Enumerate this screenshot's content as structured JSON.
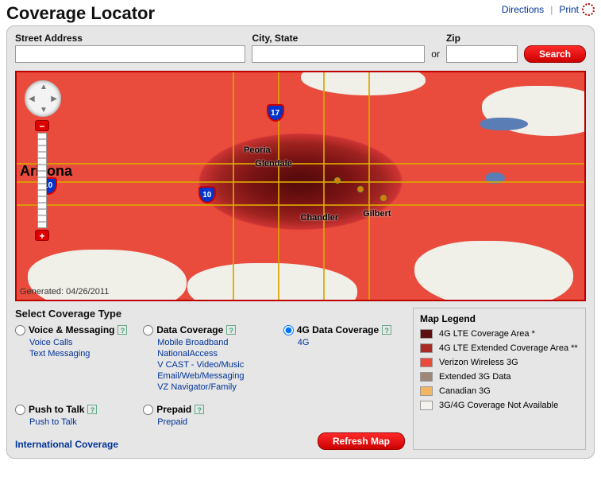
{
  "header": {
    "title": "Coverage Locator",
    "links": {
      "directions": "Directions",
      "print": "Print"
    }
  },
  "search": {
    "street_label": "Street Address",
    "city_label": "City, State",
    "zip_label": "Zip",
    "or": "or",
    "button": "Search"
  },
  "map": {
    "state_label": "Arizona",
    "generated_label": "Generated: 04/26/2011",
    "shields": {
      "i17": "17",
      "i10a": "10",
      "i10b": "10"
    },
    "cities": {
      "peoria": "Peoria",
      "glendale": "Glendale",
      "chandler": "Chandler",
      "gilbert": "Gilbert"
    }
  },
  "coverage": {
    "heading": "Select Coverage Type",
    "voice": {
      "label": "Voice & Messaging",
      "items": [
        "Voice Calls",
        "Text Messaging"
      ]
    },
    "data": {
      "label": "Data Coverage",
      "items": [
        "Mobile Broadband",
        "NationalAccess",
        "V CAST - Video/Music",
        "Email/Web/Messaging",
        "VZ Navigator/Family"
      ]
    },
    "fourg": {
      "label": "4G Data Coverage",
      "items": [
        "4G"
      ]
    },
    "ptt": {
      "label": "Push to Talk",
      "items": [
        "Push to Talk"
      ]
    },
    "prepaid": {
      "label": "Prepaid",
      "items": [
        "Prepaid"
      ]
    },
    "intl": "International Coverage",
    "refresh": "Refresh Map"
  },
  "legend": {
    "heading": "Map Legend",
    "items": [
      {
        "color": "#5e0f0f",
        "label": "4G LTE Coverage Area *"
      },
      {
        "color": "#a82a25",
        "label": "4G LTE Extended Coverage Area **"
      },
      {
        "color": "#e94b3c",
        "label": "Verizon Wireless 3G"
      },
      {
        "color": "#9e8678",
        "label": "Extended 3G Data"
      },
      {
        "color": "#f2b661",
        "label": "Canadian 3G"
      },
      {
        "color": "#f3f2ec",
        "label": "3G/4G Coverage Not Available"
      }
    ]
  }
}
